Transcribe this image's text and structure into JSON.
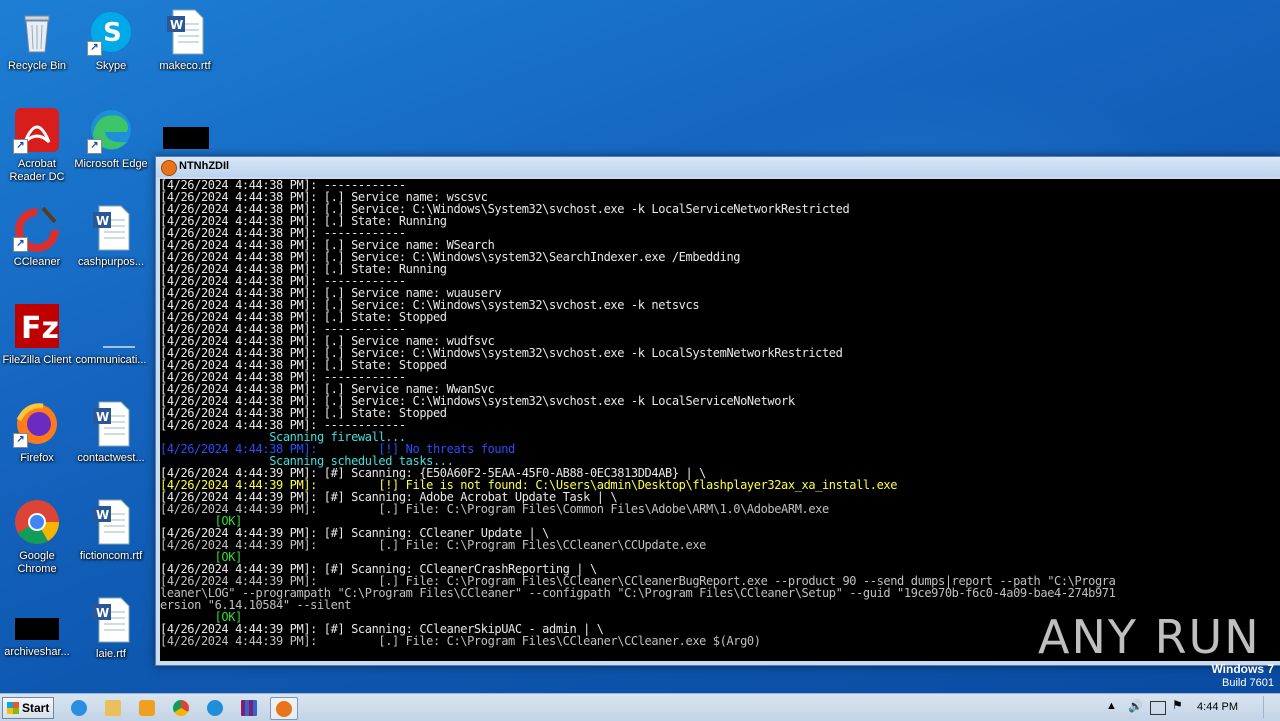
{
  "desktop": {
    "icons": [
      {
        "label": "Recycle Bin",
        "icon": "recycle-bin-icon"
      },
      {
        "label": "Skype",
        "icon": "skype-icon"
      },
      {
        "label": "makeco.rtf",
        "icon": "word-doc-icon"
      },
      {
        "label": "Acrobat Reader DC",
        "icon": "acrobat-icon"
      },
      {
        "label": "Microsoft Edge",
        "icon": "edge-icon"
      },
      {
        "label": "CCleaner",
        "icon": "ccleaner-icon"
      },
      {
        "label": "cashpurpos...",
        "icon": "word-doc-icon"
      },
      {
        "label": "FileZilla Client",
        "icon": "filezilla-icon"
      },
      {
        "label": "communicati...",
        "icon": "blank-icon"
      },
      {
        "label": "Firefox",
        "icon": "firefox-icon"
      },
      {
        "label": "contactwest...",
        "icon": "word-doc-icon"
      },
      {
        "label": "Google Chrome",
        "icon": "chrome-icon"
      },
      {
        "label": "fictioncom.rtf",
        "icon": "word-doc-icon"
      },
      {
        "label": "archiveshar...",
        "icon": "redacted-icon"
      },
      {
        "label": "laie.rtf",
        "icon": "word-doc-icon"
      }
    ],
    "windows_brand": "Windows 7",
    "build": "Build 7601",
    "watermark": "ANY RUN"
  },
  "console_window": {
    "title": "NTNhZDIl",
    "lines": [
      {
        "c": "c-white",
        "t": "[4/26/2024 4:44:38 PM]: ------------"
      },
      {
        "c": "c-white",
        "t": "[4/26/2024 4:44:38 PM]: [.] Service name: wscsvc"
      },
      {
        "c": "c-white",
        "t": "[4/26/2024 4:44:38 PM]: [.] Service: C:\\Windows\\System32\\svchost.exe -k LocalServiceNetworkRestricted"
      },
      {
        "c": "c-white",
        "t": "[4/26/2024 4:44:38 PM]: [.] State: Running"
      },
      {
        "c": "c-white",
        "t": "[4/26/2024 4:44:38 PM]: ------------"
      },
      {
        "c": "c-white",
        "t": "[4/26/2024 4:44:38 PM]: [.] Service name: WSearch"
      },
      {
        "c": "c-white",
        "t": "[4/26/2024 4:44:38 PM]: [.] Service: C:\\Windows\\system32\\SearchIndexer.exe /Embedding"
      },
      {
        "c": "c-white",
        "t": "[4/26/2024 4:44:38 PM]: [.] State: Running"
      },
      {
        "c": "c-white",
        "t": "[4/26/2024 4:44:38 PM]: ------------"
      },
      {
        "c": "c-white",
        "t": "[4/26/2024 4:44:38 PM]: [.] Service name: wuauserv"
      },
      {
        "c": "c-white",
        "t": "[4/26/2024 4:44:38 PM]: [.] Service: C:\\Windows\\system32\\svchost.exe -k netsvcs"
      },
      {
        "c": "c-white",
        "t": "[4/26/2024 4:44:38 PM]: [.] State: Stopped"
      },
      {
        "c": "c-white",
        "t": "[4/26/2024 4:44:38 PM]: ------------"
      },
      {
        "c": "c-white",
        "t": "[4/26/2024 4:44:38 PM]: [.] Service name: wudfsvc"
      },
      {
        "c": "c-white",
        "t": "[4/26/2024 4:44:38 PM]: [.] Service: C:\\Windows\\system32\\svchost.exe -k LocalSystemNetworkRestricted"
      },
      {
        "c": "c-white",
        "t": "[4/26/2024 4:44:38 PM]: [.] State: Stopped"
      },
      {
        "c": "c-white",
        "t": "[4/26/2024 4:44:38 PM]: ------------"
      },
      {
        "c": "c-white",
        "t": "[4/26/2024 4:44:38 PM]: [.] Service name: WwanSvc"
      },
      {
        "c": "c-white",
        "t": "[4/26/2024 4:44:38 PM]: [.] Service: C:\\Windows\\system32\\svchost.exe -k LocalServiceNoNetwork"
      },
      {
        "c": "c-white",
        "t": "[4/26/2024 4:44:38 PM]: [.] State: Stopped"
      },
      {
        "c": "c-white",
        "t": "[4/26/2024 4:44:38 PM]: ------------"
      },
      {
        "c": "c-cyan",
        "t": "                Scanning firewall..."
      },
      {
        "c": "c-blue",
        "t": "[4/26/2024 4:44:38 PM]:         [!] No threats found"
      },
      {
        "c": "c-cyan",
        "t": "                Scanning scheduled tasks..."
      },
      {
        "c": "c-white",
        "t": "[4/26/2024 4:44:39 PM]: [#] Scanning: {E50A60F2-5EAA-45F0-AB88-0EC3813DD4AB} | \\"
      },
      {
        "c": "c-yellow",
        "t": "[4/26/2024 4:44:39 PM]:         [!] File is not found: C:\\Users\\admin\\Desktop\\flashplayer32ax_xa_install.exe"
      },
      {
        "c": "c-white",
        "t": "[4/26/2024 4:44:39 PM]: [#] Scanning: Adobe Acrobat Update Task | \\"
      },
      {
        "c": "c-gray",
        "t": "[4/26/2024 4:44:39 PM]:         [.] File: C:\\Program Files\\Common Files\\Adobe\\ARM\\1.0\\AdobeARM.exe"
      },
      {
        "c": "c-green",
        "t": "        [OK]"
      },
      {
        "c": "c-white",
        "t": "[4/26/2024 4:44:39 PM]: [#] Scanning: CCleaner Update | \\"
      },
      {
        "c": "c-gray",
        "t": "[4/26/2024 4:44:39 PM]:         [.] File: C:\\Program Files\\CCleaner\\CCUpdate.exe"
      },
      {
        "c": "c-green",
        "t": "        [OK]"
      },
      {
        "c": "c-white",
        "t": "[4/26/2024 4:44:39 PM]: [#] Scanning: CCleanerCrashReporting | \\"
      },
      {
        "c": "c-gray",
        "t": "[4/26/2024 4:44:39 PM]:         [.] File: C:\\Program Files\\CCleaner\\CCleanerBugReport.exe --product 90 --send dumps|report --path \"C:\\Progra"
      },
      {
        "c": "c-gray",
        "t": "leaner\\LOG\" --programpath \"C:\\Program Files\\CCleaner\" --configpath \"C:\\Program Files\\CCleaner\\Setup\" --guid \"19ce970b-f6c0-4a09-bae4-274b971"
      },
      {
        "c": "c-gray",
        "t": "ersion \"6.14.10584\" --silent"
      },
      {
        "c": "c-green",
        "t": "        [OK]"
      },
      {
        "c": "c-white",
        "t": "[4/26/2024 4:44:39 PM]: [#] Scanning: CCleanerSkipUAC - admin | \\"
      },
      {
        "c": "c-gray",
        "t": "[4/26/2024 4:44:39 PM]:         [.] File: C:\\Program Files\\CCleaner\\CCleaner.exe $(Arg0)"
      }
    ]
  },
  "taskbar": {
    "start_label": "Start",
    "items": [
      "ie-icon",
      "explorer-icon",
      "media-player-icon",
      "chrome-icon",
      "edge-icon",
      "winrar-icon",
      "avast-icon"
    ],
    "clock": "4:44 PM"
  }
}
